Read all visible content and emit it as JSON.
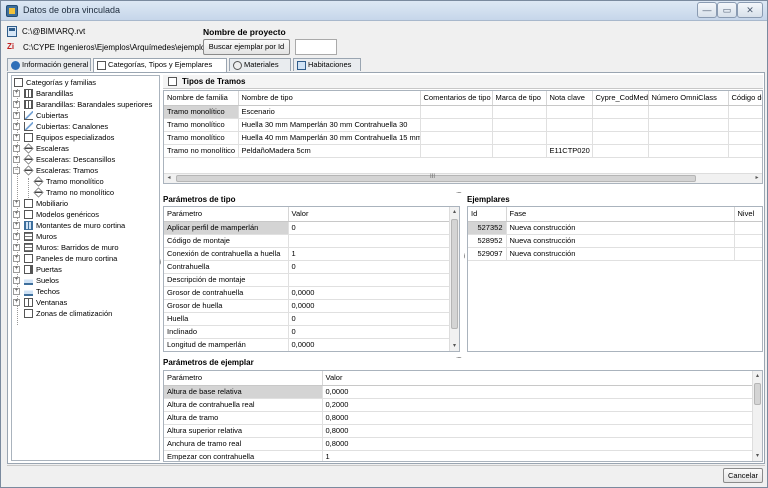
{
  "window": {
    "title": "Datos de obra vinculada",
    "min_glyph": "—",
    "max_glyph": "▭",
    "close_glyph": "✕"
  },
  "header": {
    "rvt_path": "C:\\@BIM\\ARQ.rvt",
    "project_name_label": "Nombre de proyecto",
    "cype_icon_text": "Zi",
    "example_path": "C:\\CYPE Ingenieros\\Ejemplos\\Arquímedes\\ejemplo1",
    "find_button": "Buscar ejemplar por Id",
    "find_value": ""
  },
  "tabs": [
    {
      "label": "Información general",
      "icon": "info-icon"
    },
    {
      "label": "Categorías, Tipos y Ejemplares",
      "icon": "list-icon"
    },
    {
      "label": "Materiales",
      "icon": "material-icon"
    },
    {
      "label": "Habitaciones",
      "icon": "rooms-icon"
    }
  ],
  "tree": {
    "root": "Categorías y familias",
    "items": [
      {
        "label": "Barandillas",
        "icon": "railing-icon"
      },
      {
        "label": "Barandillas: Barandales superiores",
        "icon": "railing-icon"
      },
      {
        "label": "Cubiertas",
        "icon": "roof-icon"
      },
      {
        "label": "Cubiertas: Canalones",
        "icon": "roof-icon"
      },
      {
        "label": "Equipos especializados",
        "icon": "doc-icon"
      },
      {
        "label": "Escaleras",
        "icon": "stair-icon"
      },
      {
        "label": "Escaleras: Descansillos",
        "icon": "stair-icon"
      },
      {
        "label": "Escaleras: Tramos",
        "icon": "stair-icon"
      },
      {
        "label": "Tramo monolítico",
        "icon": "stair-icon"
      },
      {
        "label": "Tramo no monolítico",
        "icon": "stair-icon"
      },
      {
        "label": "Mobiliario",
        "icon": "doc-icon"
      },
      {
        "label": "Modelos genéricos",
        "icon": "doc-icon"
      },
      {
        "label": "Montantes de muro cortina",
        "icon": "grid-icon"
      },
      {
        "label": "Muros",
        "icon": "wall-icon"
      },
      {
        "label": "Muros: Barridos de muro",
        "icon": "wall-icon"
      },
      {
        "label": "Paneles de muro cortina",
        "icon": "doc-icon"
      },
      {
        "label": "Puertas",
        "icon": "door-icon"
      },
      {
        "label": "Suelos",
        "icon": "floor-icon"
      },
      {
        "label": "Techos",
        "icon": "floor-icon"
      },
      {
        "label": "Ventanas",
        "icon": "window-icon"
      },
      {
        "label": "Zonas de climatización",
        "icon": "doc-icon"
      }
    ],
    "expander": "+",
    "collapser": "−"
  },
  "tramos": {
    "title": "Tipos de Tramos",
    "columns": [
      "Nombre de familia",
      "Nombre de tipo",
      "Comentarios de tipo",
      "Marca de tipo",
      "Nota clave",
      "Cypre_CodMed",
      "Número OmniClass",
      "Código de m"
    ],
    "rows": [
      [
        "Tramo monolítico",
        "Escenario",
        "",
        "",
        "",
        "",
        "",
        ""
      ],
      [
        "Tramo monolítico",
        "Huella 30 mm Mamperlán 30 mm Contrahuella 30",
        "",
        "",
        "",
        "",
        "",
        ""
      ],
      [
        "Tramo monolítico",
        "Huella 40 mm Mamperlán 30 mm Contrahuella 15 mm",
        "",
        "",
        "",
        "",
        "",
        ""
      ],
      [
        "Tramo no monolítico",
        "PeldañoMadera 5cm",
        "",
        "",
        "E11CTP020",
        "",
        "",
        ""
      ]
    ],
    "scroll_mid": "III"
  },
  "tipo": {
    "title": "Parámetros de tipo",
    "columns": [
      "Parámetro",
      "Valor"
    ],
    "rows": [
      [
        "Aplicar perfil de mamperlán",
        "0"
      ],
      [
        "Código de montaje",
        ""
      ],
      [
        "Conexión de contrahuella a huella",
        "1"
      ],
      [
        "Contrahuella",
        "0"
      ],
      [
        "Descripción de montaje",
        ""
      ],
      [
        "Grosor de contrahuella",
        "0,0000"
      ],
      [
        "Grosor de huella",
        "0,0000"
      ],
      [
        "Huella",
        "0"
      ],
      [
        "Inclinado",
        "0"
      ],
      [
        "Longitud de mamperlán",
        "0,0000"
      ]
    ]
  },
  "ejemplares": {
    "title": "Ejemplares",
    "columns": [
      "Id",
      "Fase",
      "Nivel"
    ],
    "rows": [
      [
        "527352",
        "Nueva construcción",
        ""
      ],
      [
        "528952",
        "Nueva construcción",
        ""
      ],
      [
        "529097",
        "Nueva construcción",
        ""
      ]
    ]
  },
  "ejemplar": {
    "title": "Parámetros de ejemplar",
    "columns": [
      "Parámetro",
      "Valor"
    ],
    "rows": [
      [
        "Altura de base relativa",
        "0,0000"
      ],
      [
        "Altura de contrahuella real",
        "0,2000"
      ],
      [
        "Altura de tramo",
        "0,8000"
      ],
      [
        "Altura superior relativa",
        "0,8000"
      ],
      [
        "Anchura de tramo real",
        "0,8000"
      ],
      [
        "Empezar con contrahuella",
        "1"
      ]
    ]
  },
  "footer": {
    "cancel_button": "Cancelar"
  },
  "splitter_glyph": "....",
  "arrows": {
    "left": "◂",
    "right": "▸",
    "up": "▴",
    "down": "▾"
  }
}
